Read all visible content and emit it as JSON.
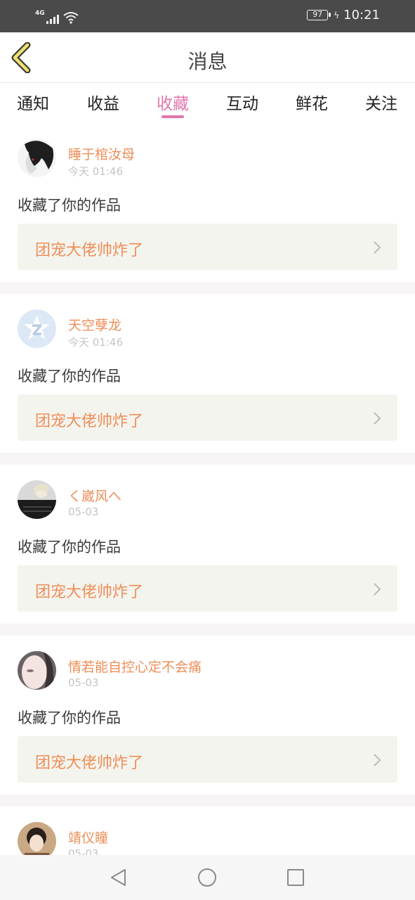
{
  "status_bar": {
    "network": "4G",
    "battery": "97",
    "time": "10:21",
    "icons": [
      "signal-icon",
      "wifi-icon",
      "battery-icon",
      "charging-icon"
    ]
  },
  "header": {
    "title": "消息",
    "back_icon": "chevron-left-icon"
  },
  "tabs": [
    {
      "label": "通知",
      "active": false
    },
    {
      "label": "收益",
      "active": false
    },
    {
      "label": "收藏",
      "active": true
    },
    {
      "label": "互动",
      "active": false
    },
    {
      "label": "鲜花",
      "active": false
    },
    {
      "label": "关注",
      "active": false
    }
  ],
  "colors": {
    "accent": "#e276ac",
    "name": "#ee8e58",
    "work_bg": "#f4f4ee"
  },
  "items": [
    {
      "name": "睡于棺汝母",
      "time": "今天 01:46",
      "action": "收藏了你的作品",
      "work": "团宠大佬帅炸了"
    },
    {
      "name": "天空孽龙",
      "time": "今天 01:46",
      "action": "收藏了你的作品",
      "work": "团宠大佬帅炸了"
    },
    {
      "name": "く崴风へ",
      "time": "05-03",
      "action": "收藏了你的作品",
      "work": "团宠大佬帅炸了"
    },
    {
      "name": "情若能自控心定不会痛",
      "time": "05-03",
      "action": "收藏了你的作品",
      "work": "团宠大佬帅炸了"
    },
    {
      "name": "靖仪瞳",
      "time": "05-03"
    }
  ],
  "nav_bar": [
    "back-triangle-icon",
    "home-circle-icon",
    "recents-square-icon"
  ]
}
